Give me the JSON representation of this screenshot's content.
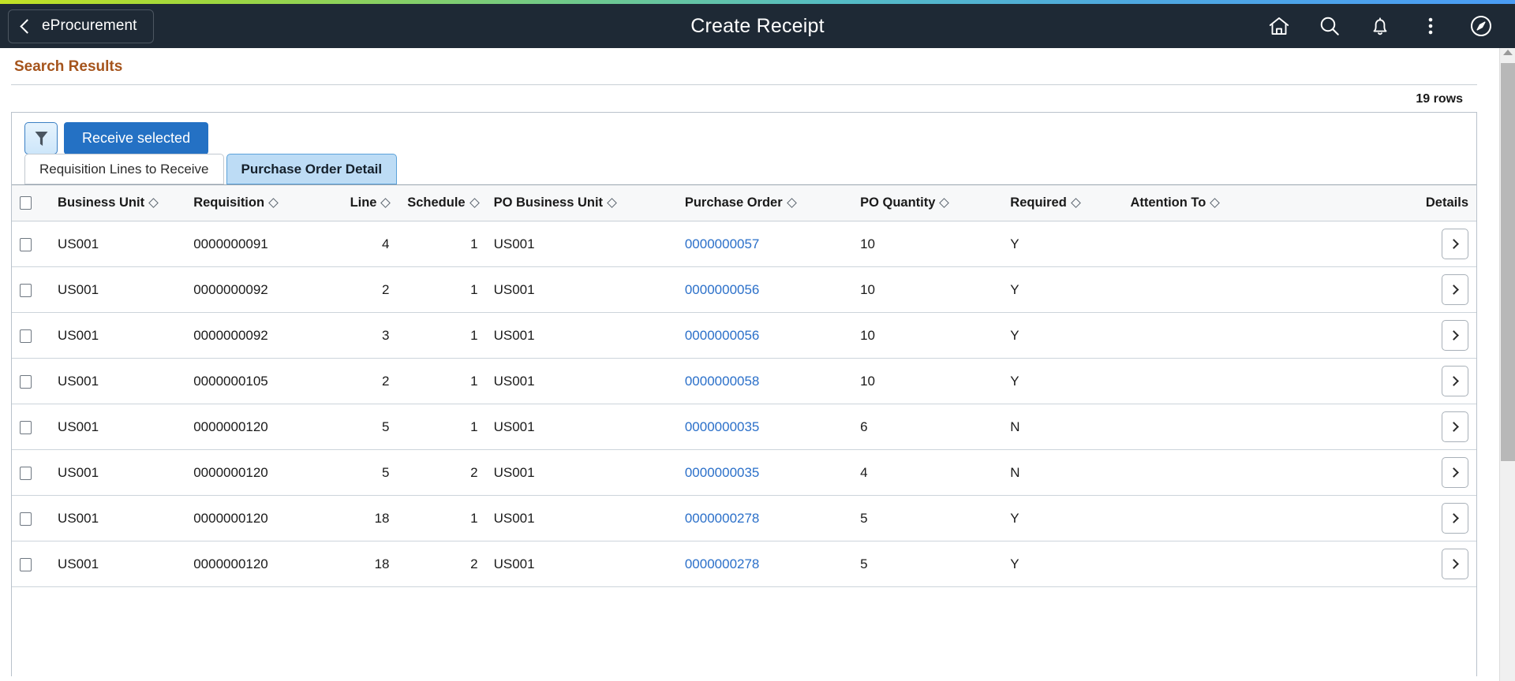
{
  "header": {
    "back_label": "eProcurement",
    "back_icon": "chevron-left-icon",
    "title": "Create Receipt",
    "icons": [
      {
        "name": "home-icon",
        "label": "Home"
      },
      {
        "name": "search-icon",
        "label": "Search"
      },
      {
        "name": "notifications-bell-icon",
        "label": "Notifications"
      },
      {
        "name": "actions-menu-icon",
        "label": "Actions"
      },
      {
        "name": "navigator-compass-icon",
        "label": "NavBar"
      }
    ]
  },
  "page": {
    "section_title": "Search Results",
    "rows_count_label": "19 rows"
  },
  "toolbar": {
    "filter_label": "Filter",
    "filter_icon": "funnel-filter-icon",
    "receive_selected_label": "Receive selected"
  },
  "tabs": [
    {
      "label": "Requisition Lines to Receive",
      "active": false
    },
    {
      "label": "Purchase Order Detail",
      "active": true
    }
  ],
  "table": {
    "select_all_checked": false,
    "columns": [
      {
        "key": "select",
        "label": "",
        "sortable": false,
        "align": "left"
      },
      {
        "key": "business_unit",
        "label": "Business Unit",
        "sortable": true,
        "align": "left"
      },
      {
        "key": "requisition",
        "label": "Requisition",
        "sortable": true,
        "align": "left"
      },
      {
        "key": "line",
        "label": "Line",
        "sortable": true,
        "align": "right"
      },
      {
        "key": "schedule",
        "label": "Schedule",
        "sortable": true,
        "align": "right"
      },
      {
        "key": "po_business_unit",
        "label": "PO Business Unit",
        "sortable": true,
        "align": "left"
      },
      {
        "key": "purchase_order",
        "label": "Purchase Order",
        "sortable": true,
        "align": "left"
      },
      {
        "key": "po_quantity",
        "label": "PO Quantity",
        "sortable": true,
        "align": "left"
      },
      {
        "key": "required",
        "label": "Required",
        "sortable": true,
        "align": "left"
      },
      {
        "key": "attention_to",
        "label": "Attention To",
        "sortable": true,
        "align": "left"
      },
      {
        "key": "details",
        "label": "Details",
        "sortable": false,
        "align": "right"
      }
    ],
    "rows": [
      {
        "business_unit": "US001",
        "requisition": "0000000091",
        "line": "4",
        "schedule": "1",
        "po_business_unit": "US001",
        "purchase_order": "0000000057",
        "po_quantity": "10",
        "required": "Y",
        "attention_to": "",
        "details_icon": "chevron-right-icon"
      },
      {
        "business_unit": "US001",
        "requisition": "0000000092",
        "line": "2",
        "schedule": "1",
        "po_business_unit": "US001",
        "purchase_order": "0000000056",
        "po_quantity": "10",
        "required": "Y",
        "attention_to": "",
        "details_icon": "chevron-right-icon"
      },
      {
        "business_unit": "US001",
        "requisition": "0000000092",
        "line": "3",
        "schedule": "1",
        "po_business_unit": "US001",
        "purchase_order": "0000000056",
        "po_quantity": "10",
        "required": "Y",
        "attention_to": "",
        "details_icon": "chevron-right-icon"
      },
      {
        "business_unit": "US001",
        "requisition": "0000000105",
        "line": "2",
        "schedule": "1",
        "po_business_unit": "US001",
        "purchase_order": "0000000058",
        "po_quantity": "10",
        "required": "Y",
        "attention_to": "",
        "details_icon": "chevron-right-icon"
      },
      {
        "business_unit": "US001",
        "requisition": "0000000120",
        "line": "5",
        "schedule": "1",
        "po_business_unit": "US001",
        "purchase_order": "0000000035",
        "po_quantity": "6",
        "required": "N",
        "attention_to": "",
        "details_icon": "chevron-right-icon"
      },
      {
        "business_unit": "US001",
        "requisition": "0000000120",
        "line": "5",
        "schedule": "2",
        "po_business_unit": "US001",
        "purchase_order": "0000000035",
        "po_quantity": "4",
        "required": "N",
        "attention_to": "",
        "details_icon": "chevron-right-icon"
      },
      {
        "business_unit": "US001",
        "requisition": "0000000120",
        "line": "18",
        "schedule": "1",
        "po_business_unit": "US001",
        "purchase_order": "0000000278",
        "po_quantity": "5",
        "required": "Y",
        "attention_to": "",
        "details_icon": "chevron-right-icon"
      },
      {
        "business_unit": "US001",
        "requisition": "0000000120",
        "line": "18",
        "schedule": "2",
        "po_business_unit": "US001",
        "purchase_order": "0000000278",
        "po_quantity": "5",
        "required": "Y",
        "attention_to": "",
        "details_icon": "chevron-right-icon"
      }
    ]
  },
  "colors": {
    "header_bg": "#1e2935",
    "section_title": "#a5541c",
    "primary_button": "#2471c4",
    "link": "#2a6fc9",
    "active_tab_bg": "#bddcf5"
  },
  "scrollbar": {
    "up_arrow_icon": "scroll-up-arrow-icon"
  }
}
